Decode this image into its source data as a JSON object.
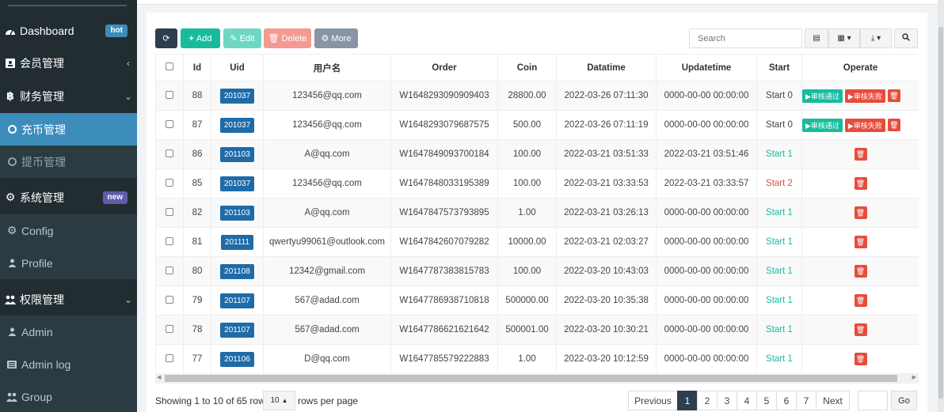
{
  "sidebar": {
    "items": [
      {
        "label": "Dashboard",
        "badge": "hot"
      },
      {
        "label": "会员管理"
      },
      {
        "label": "财务管理"
      },
      {
        "label": "充币管理"
      },
      {
        "label": "提币管理"
      },
      {
        "label": "系统管理",
        "badge": "new"
      },
      {
        "label": "Config"
      },
      {
        "label": "Profile"
      },
      {
        "label": "权限管理"
      },
      {
        "label": "Admin"
      },
      {
        "label": "Admin log"
      },
      {
        "label": "Group"
      }
    ]
  },
  "toolbar": {
    "add_label": "Add",
    "edit_label": "Edit",
    "delete_label": "Delete",
    "more_label": "More",
    "search_placeholder": "Search"
  },
  "table": {
    "headers": [
      "Id",
      "Uid",
      "用户名",
      "Order",
      "Coin",
      "Datatime",
      "Updatetime",
      "Start",
      "Operate"
    ],
    "approve_label": "▶审核通过",
    "reject_label": "▶审核失败",
    "rows": [
      {
        "id": "88",
        "uid": "201037",
        "user": "123456@qq.com",
        "order": "W1648293090909403",
        "coin": "28800.00",
        "datatime": "2022-03-26 07:11:30",
        "updatetime": "0000-00-00 00:00:00",
        "start": "Start 0"
      },
      {
        "id": "87",
        "uid": "201037",
        "user": "123456@qq.com",
        "order": "W1648293079687575",
        "coin": "500.00",
        "datatime": "2022-03-26 07:11:19",
        "updatetime": "0000-00-00 00:00:00",
        "start": "Start 0"
      },
      {
        "id": "86",
        "uid": "201103",
        "user": "A@qq.com",
        "order": "W1647849093700184",
        "coin": "100.00",
        "datatime": "2022-03-21 03:51:33",
        "updatetime": "2022-03-21 03:51:46",
        "start": "Start 1"
      },
      {
        "id": "85",
        "uid": "201037",
        "user": "123456@qq.com",
        "order": "W1647848033195389",
        "coin": "100.00",
        "datatime": "2022-03-21 03:33:53",
        "updatetime": "2022-03-21 03:33:57",
        "start": "Start 2"
      },
      {
        "id": "82",
        "uid": "201103",
        "user": "A@qq.com",
        "order": "W1647847573793895",
        "coin": "1.00",
        "datatime": "2022-03-21 03:26:13",
        "updatetime": "0000-00-00 00:00:00",
        "start": "Start 1"
      },
      {
        "id": "81",
        "uid": "201111",
        "user": "qwertyu99061@outlook.com",
        "order": "W1647842607079282",
        "coin": "10000.00",
        "datatime": "2022-03-21 02:03:27",
        "updatetime": "0000-00-00 00:00:00",
        "start": "Start 1"
      },
      {
        "id": "80",
        "uid": "201108",
        "user": "12342@gmail.com",
        "order": "W1647787383815783",
        "coin": "100.00",
        "datatime": "2022-03-20 10:43:03",
        "updatetime": "0000-00-00 00:00:00",
        "start": "Start 1"
      },
      {
        "id": "79",
        "uid": "201107",
        "user": "567@adad.com",
        "order": "W1647786938710818",
        "coin": "500000.00",
        "datatime": "2022-03-20 10:35:38",
        "updatetime": "0000-00-00 00:00:00",
        "start": "Start 1"
      },
      {
        "id": "78",
        "uid": "201107",
        "user": "567@adad.com",
        "order": "W1647786621621642",
        "coin": "500001.00",
        "datatime": "2022-03-20 10:30:21",
        "updatetime": "0000-00-00 00:00:00",
        "start": "Start 1"
      },
      {
        "id": "77",
        "uid": "201106",
        "user": "D@qq.com",
        "order": "W1647785579222883",
        "coin": "1.00",
        "datatime": "2022-03-20 10:12:59",
        "updatetime": "0000-00-00 00:00:00",
        "start": "Start 1"
      }
    ]
  },
  "footer": {
    "showing": "Showing 1 to 10 of 65 rows",
    "page_size": "10",
    "rows_per_page": "rows per page",
    "previous": "Previous",
    "next": "Next",
    "go": "Go",
    "pages": [
      "1",
      "2",
      "3",
      "4",
      "5",
      "6",
      "7"
    ]
  },
  "colors": {
    "sidebar_bg": "#222d32",
    "sidebar_active": "#3c8dbc",
    "add": "#18bc9c",
    "delete": "#e74c3c",
    "uid_badge": "#1f6ba8",
    "pager_active": "#2c3e50"
  }
}
